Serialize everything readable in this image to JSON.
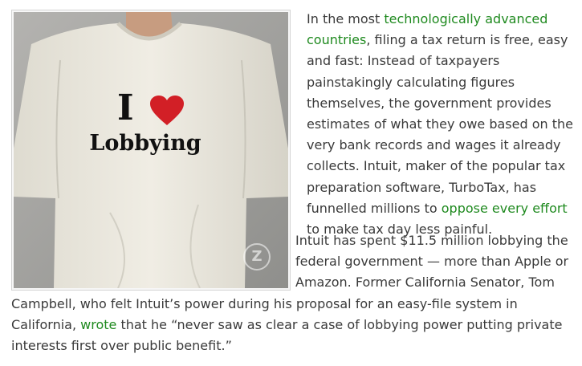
{
  "figure": {
    "shirt_line1_letter": "I",
    "shirt_line2": "Lobbying",
    "watermark": "Z",
    "heart_icon": "heart-icon"
  },
  "paragraph1": {
    "t1": "In the most ",
    "link1": "technologically advanced countries",
    "t2": ", filing a tax return is free, easy and fast: Instead of taxpayers painstakingly calculating figures themselves, the government provides estimates of what they owe based on the very bank records and wages it already collects. Intuit, maker of the popular tax preparation software, TurboTax, has funnelled millions to ",
    "link2": "oppose every effort",
    "t3": " to make tax day less painful."
  },
  "paragraph2": {
    "t1": "Intuit has spent $11.5 million lobbying the federal government — more than Apple or Amazon. Former California Senator, Tom Campbell, who felt Intuit’s power during his proposal for an easy-file system in California, ",
    "link1": "wrote",
    "t2": " that he “never saw as clear a case of lobbying power putting private interests first over public benefit.”"
  },
  "colors": {
    "link": "#1f8a1f",
    "text": "#3a3a3a",
    "heart": "#d21f26"
  }
}
